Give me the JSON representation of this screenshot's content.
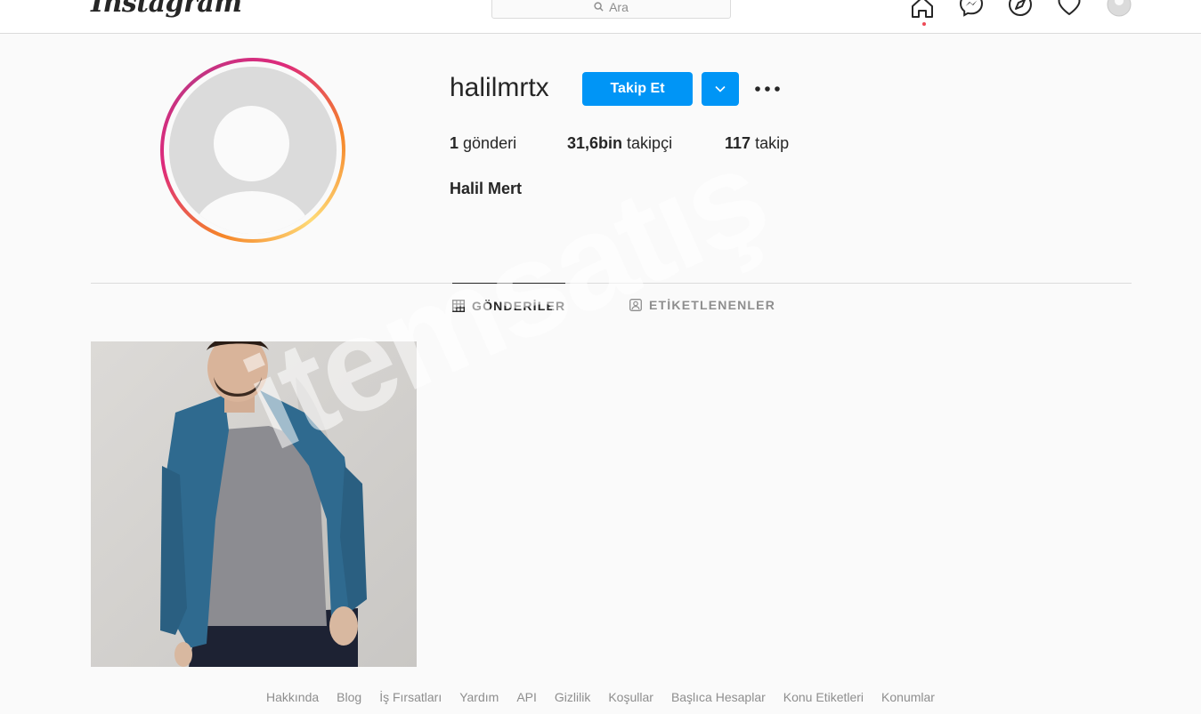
{
  "nav": {
    "logo": "Instagram",
    "search_placeholder": "Ara",
    "icons": [
      "home-icon",
      "messenger-icon",
      "explore-icon",
      "heart-icon",
      "profile-avatar-icon"
    ]
  },
  "profile": {
    "username": "halilmrtx",
    "follow_label": "Takip Et",
    "full_name": "Halil Mert",
    "stats": {
      "posts_count": "1",
      "posts_label": "gönderi",
      "followers_count": "31,6bin",
      "followers_label": "takipçi",
      "following_count": "117",
      "following_label": "takip"
    }
  },
  "tabs": {
    "posts": "GÖNDERİLER",
    "tagged": "ETİKETLENENLER"
  },
  "footer": {
    "links": [
      "Hakkında",
      "Blog",
      "İş Fırsatları",
      "Yardım",
      "API",
      "Gizlilik",
      "Koşullar",
      "Başlıca Hesaplar",
      "Konu Etiketleri",
      "Konumlar"
    ]
  },
  "watermark": "itemsatış",
  "colors": {
    "primary_button": "#0095f6",
    "background": "#fafafa",
    "notification_dot": "#ed4956"
  }
}
